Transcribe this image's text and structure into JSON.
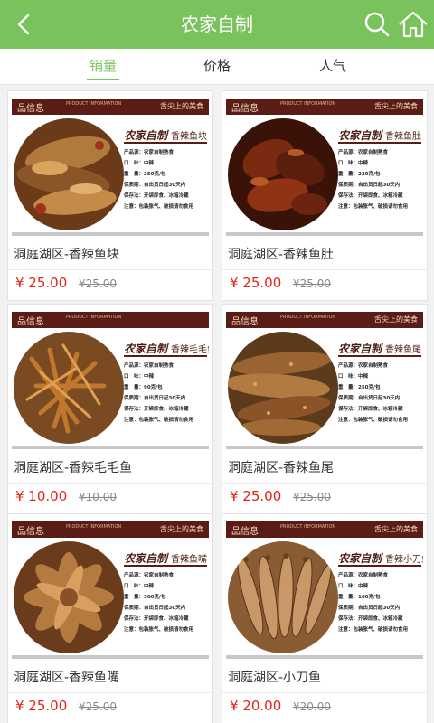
{
  "header": {
    "title": "农家自制"
  },
  "tabs": [
    {
      "label": "销量",
      "active": true
    },
    {
      "label": "价格",
      "active": false
    },
    {
      "label": "人气",
      "active": false
    }
  ],
  "poster": {
    "brand": "品信息",
    "slogan": "舌尖上的美食",
    "en": "PRODUCT INFORMATION",
    "tag": "农家自制",
    "lines": [
      "产品源：农家自制熟食",
      "口　味：中辣",
      "保质期：自出货日起30天内",
      "保存法：开袋即食、冰箱冷藏",
      "注意：包装胀气、破损请勿食用"
    ]
  },
  "products": [
    {
      "name": "洞庭湖区-香辣鱼块",
      "price": "¥ 25.00",
      "old_price": "¥25.00",
      "poster_title": "香辣鱼块",
      "weight": "重　量：250克/包",
      "theme": "fish-block"
    },
    {
      "name": "洞庭湖区-香辣鱼肚",
      "price": "¥ 25.00",
      "old_price": "¥25.00",
      "poster_title": "香辣鱼肚",
      "weight": "重　量：220克/包",
      "theme": "fish-belly"
    },
    {
      "name": "洞庭湖区-香辣毛毛鱼",
      "price": "¥ 10.00",
      "old_price": "¥10.00",
      "poster_title": "香辣毛毛鱼",
      "weight": "重　量：90克/包",
      "theme": "fish-small"
    },
    {
      "name": "洞庭湖区-香辣鱼尾",
      "price": "¥ 25.00",
      "old_price": "¥25.00",
      "poster_title": "香辣鱼尾",
      "weight": "重　量：250克/包",
      "theme": "fish-tail"
    },
    {
      "name": "洞庭湖区-香辣鱼嘴",
      "price": "¥ 25.00",
      "old_price": "¥25.00",
      "poster_title": "香辣鱼嘴",
      "weight": "重　量：300克/包",
      "theme": "fish-mouth"
    },
    {
      "name": "洞庭湖区-小刀鱼",
      "price": "¥ 20.00",
      "old_price": "¥20.00",
      "poster_title": "香辣小刀鱼",
      "weight": "重　量：160克/包",
      "theme": "fish-knife"
    }
  ],
  "colors": {
    "primary": "#7ac25c",
    "price": "#e2231a",
    "poster": "#5a1c14"
  }
}
